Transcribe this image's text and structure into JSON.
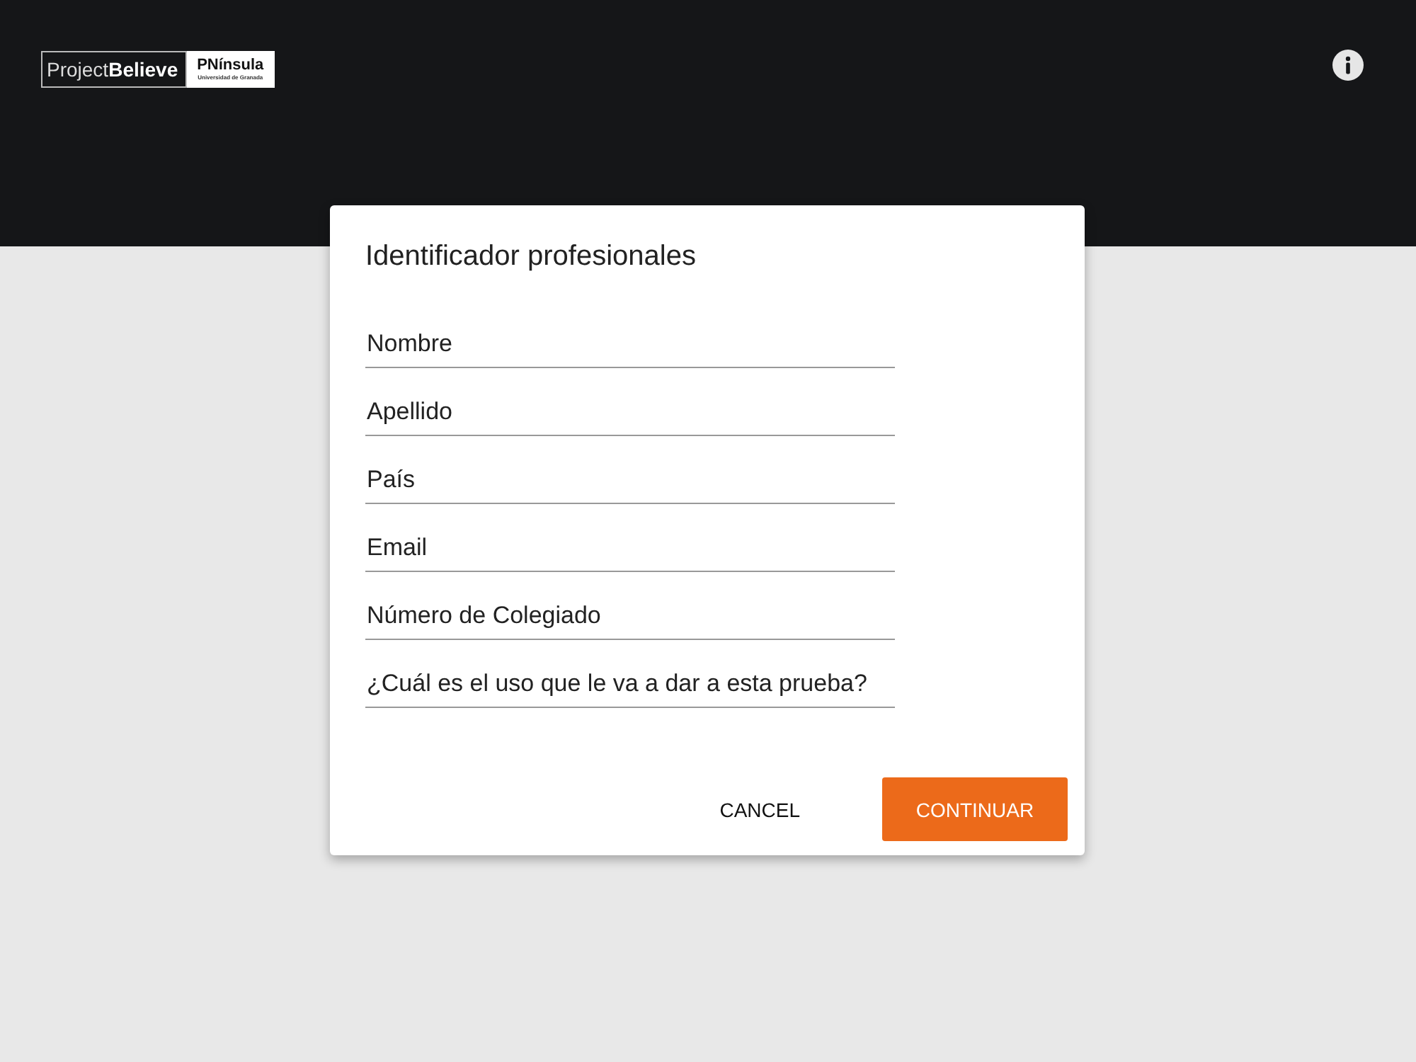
{
  "header": {
    "logo": {
      "left": "Project**Believe**",
      "right_title": "PNínsula",
      "right_subtitle": "Universidad de Granada"
    }
  },
  "dialog": {
    "title": "Identificador profesionales",
    "fields": [
      {
        "placeholder": "Nombre"
      },
      {
        "placeholder": "Apellido"
      },
      {
        "placeholder": "País"
      },
      {
        "placeholder": "Email"
      },
      {
        "placeholder": "Número de Colegiado"
      },
      {
        "placeholder": "¿Cuál es el uso que le va a dar a esta prueba?"
      }
    ],
    "buttons": [
      {
        "label": "CANCEL",
        "kind": "text"
      },
      {
        "label": "CONTINUAR",
        "kind": "primary"
      }
    ]
  }
}
